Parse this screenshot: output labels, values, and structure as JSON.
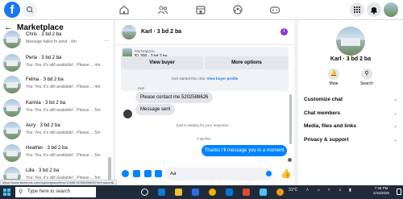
{
  "sidebar": {
    "title": "Marketplace",
    "conversations": [
      {
        "name": "Chris · 3 bd 2 ba",
        "snippet": "Message failed to send · 4m",
        "time": ""
      },
      {
        "name": "Perla · 3 bd 2 ba",
        "snippet": "You: Yes, it's still available! . Please ...",
        "time": "4m"
      },
      {
        "name": "Felina · 3 bd 2 ba",
        "snippet": "You: Yes, it's still available! . Please ...",
        "time": "4m"
      },
      {
        "name": "Karinia · 3 bd 2 ba",
        "snippet": "You: Yes, it's still available! . Please ...",
        "time": "5m"
      },
      {
        "name": "Aury · 3 bd 2 ba",
        "snippet": "You: Yes, it's still available! . Please ...",
        "time": "5m"
      },
      {
        "name": "Heather · 3 bd 2 ba",
        "snippet": "You: Yes, it's still available! . Please ...",
        "time": "5m"
      },
      {
        "name": "Lilia · 3 bd 2 ba",
        "snippet": "You: Yes, it's still available! . Please ...",
        "time": "5m"
      }
    ]
  },
  "chat": {
    "title": "Karl · 3 bd 2 ba",
    "listing_label": "Marketplace",
    "listing_price": "$1,300 · 3 bd 2 ba",
    "view_buyer": "View buyer",
    "more_options": "More options",
    "started_note": "Karl started this chat.",
    "view_buyer_profile": "View buyer profile",
    "sender_name": "Karl",
    "msg_in_1": "Please contact me 5202588626",
    "msg_in_2": "Message sent",
    "waiting_note": "Karl is waiting for your response.",
    "time": "7:48 PM",
    "msg_out": "Thanks I'll message you in a moment",
    "input_value": "Aa"
  },
  "details": {
    "name": "Karl · 3 bd 2 ba",
    "mute_label": "Mute",
    "search_label": "Search",
    "items": [
      "Customize chat",
      "Chat members",
      "Media, files and links",
      "Privacy & support"
    ]
  },
  "statusbar": "https://www.facebook.com/marketplace/item/1265678765659895/?ref=saved&...",
  "taskbar": {
    "search_placeholder": "Type here to search",
    "weather": "31°C",
    "time": "7:49 PM",
    "date": "4/15/2026"
  },
  "colors": {
    "brand": "#1877f2",
    "outgoing_bubble": "#0084ff",
    "info_icon": "#8a33d6"
  }
}
